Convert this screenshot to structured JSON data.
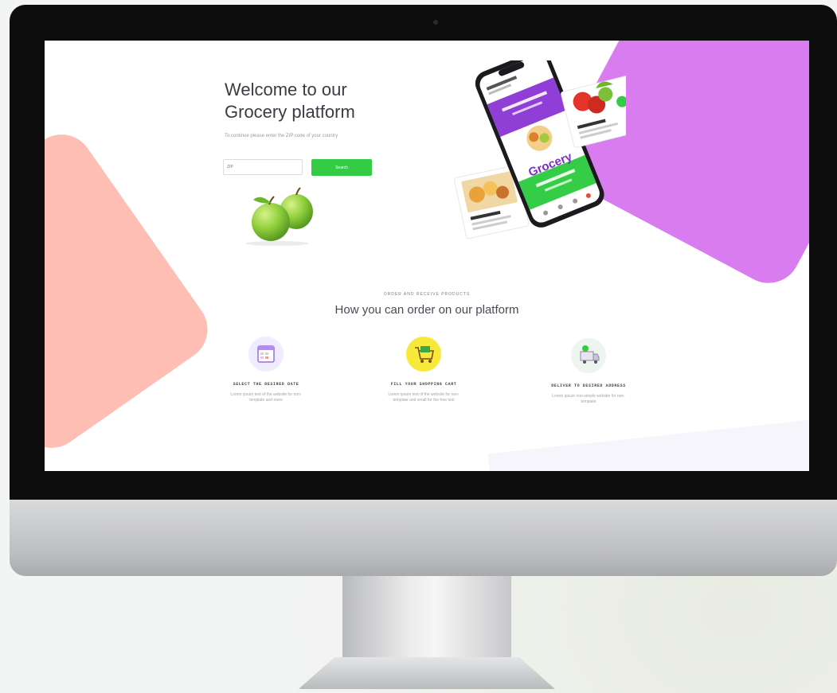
{
  "hero": {
    "title_line1": "Welcome to our",
    "title_line2": "Grocery platform",
    "subtitle": "To continue please enter the ZIP code of your country",
    "zip_placeholder": "ZIP",
    "search_label": "Search"
  },
  "phone": {
    "logo": "Grocery"
  },
  "how": {
    "label": "ORDER AND RECEIVE PRODUCTS",
    "title": "How you can order on our platform",
    "steps": [
      {
        "title": "SELECT THE DESIRED DATE",
        "desc": "Lorem ipsum text of the website for non-template and more"
      },
      {
        "title": "FILL YOUR SHOPPING CART",
        "desc": "Lorem ipsum text of the website for non-template and small for the free text"
      },
      {
        "title": "DELIVER TO DESIRED ADDRESS",
        "desc": "Lorem ipsum non-simple website for non-template"
      }
    ]
  },
  "colors": {
    "accent_green": "#33cc44",
    "purple": "#d87cf0",
    "pink": "#ffbeb4"
  }
}
